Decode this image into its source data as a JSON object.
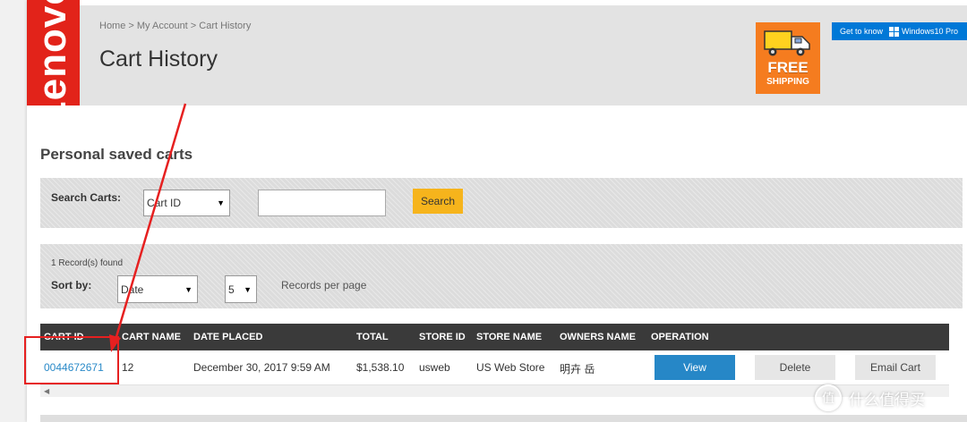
{
  "header": {
    "logo_text": "Lenovo",
    "breadcrumb": "Home > My Account > Cart History",
    "title": "Cart History",
    "promo": {
      "free": "FREE",
      "shipping": "SHIPPING"
    },
    "windows_banner": {
      "text": "Get to know",
      "product": "Windows10 Pro"
    }
  },
  "section": {
    "heading": "Personal saved carts"
  },
  "search": {
    "label": "Search Carts:",
    "field_selected": "Cart ID",
    "query_value": "",
    "button_label": "Search"
  },
  "records": {
    "found_text": "1 Record(s) found",
    "sort_label": "Sort by:",
    "sort_selected": "Date",
    "page_size_selected": "5",
    "per_page_label": "Records per page"
  },
  "table": {
    "headers": [
      "CART ID",
      "CART NAME",
      "DATE PLACED",
      "TOTAL",
      "STORE ID",
      "STORE NAME",
      "OWNERS NAME",
      "OPERATION"
    ],
    "rows": [
      {
        "cart_id": "0044672671",
        "cart_name": "12",
        "date_placed": "December 30, 2017 9:59 AM",
        "total": "$1,538.10",
        "store_id": "usweb",
        "store_name": "US Web Store",
        "owners_name": "明卉 岳",
        "actions": {
          "view": "View",
          "delete": "Delete",
          "email": "Email Cart"
        }
      }
    ]
  },
  "watermark": {
    "icon": "值",
    "text": "什么值得买"
  },
  "colors": {
    "brand_red": "#e2231a",
    "promo_orange": "#f57c1f",
    "windows_blue": "#0078d7",
    "search_yellow": "#f6b41c",
    "view_blue": "#2687c7",
    "header_dark": "#3a3a3a",
    "annotation_red": "#e62020"
  }
}
